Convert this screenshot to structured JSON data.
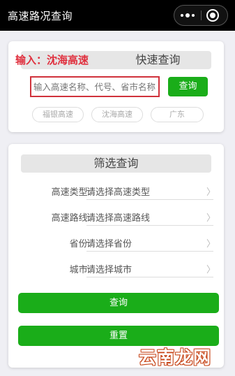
{
  "app": {
    "title": "高速路况查询"
  },
  "quick_search": {
    "annotation": "输入：沈海高速",
    "title": "快速查询",
    "input_placeholder": "输入高速名称、代号、省市名称",
    "button_label": "查询",
    "tags": [
      "福银高速",
      "沈海高速",
      "广东"
    ]
  },
  "filter": {
    "title": "筛选查询",
    "rows": [
      {
        "label": "高速类型:",
        "placeholder": "请选择高速类型"
      },
      {
        "label": "高速路线:",
        "placeholder": "请选择高速路线"
      },
      {
        "label": "省份:",
        "placeholder": "请选择省份"
      },
      {
        "label": "城市:",
        "placeholder": "请选择城市"
      }
    ],
    "query_button": "查询",
    "reset_button": "重置"
  },
  "watermark": "云南龙网",
  "colors": {
    "accent_green": "#1aad19",
    "highlight_red": "#d0323c",
    "annotation_red": "#e0313f"
  }
}
